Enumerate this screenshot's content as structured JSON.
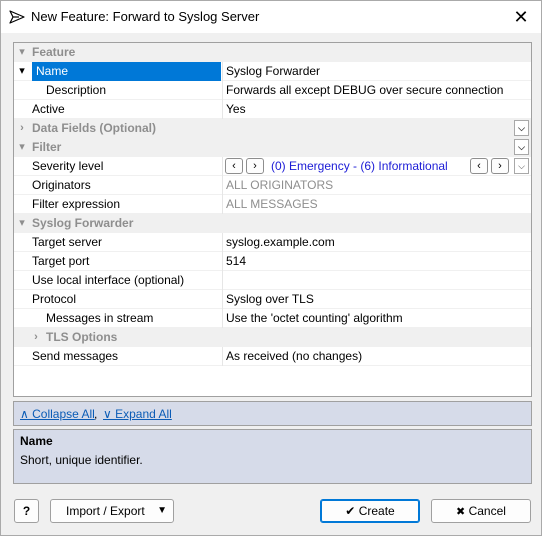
{
  "window": {
    "title": "New Feature: Forward to Syslog Server",
    "close_icon": "✕",
    "app_icon": "send-icon"
  },
  "colors": {
    "selection": "#0078d7",
    "link": "#0b5cb6",
    "category_text": "#8e8e8e",
    "panel": "#d6dbe9",
    "value_blue": "#1b1bd6"
  },
  "grid": {
    "feature": {
      "label": "Feature",
      "toggle": "▾"
    },
    "name": {
      "label": "Name",
      "value": "Syslog Forwarder",
      "toggle": "▾"
    },
    "description": {
      "label": "Description",
      "value": "Forwards all except DEBUG over secure connection"
    },
    "active": {
      "label": "Active",
      "value": "Yes"
    },
    "data_fields": {
      "label": "Data Fields (Optional)",
      "toggle": "›",
      "dropdown": "⌵"
    },
    "filter": {
      "label": "Filter",
      "toggle": "▾",
      "dropdown": "⌵"
    },
    "severity": {
      "label": "Severity level",
      "value": "(0) Emergency - (6) Informational",
      "prev": "‹",
      "next": "›",
      "dropdown": "⌵"
    },
    "originators": {
      "label": "Originators",
      "value": "ALL ORIGINATORS"
    },
    "filter_expression": {
      "label": "Filter expression",
      "value": "ALL MESSAGES"
    },
    "syslog_forwarder": {
      "label": "Syslog Forwarder",
      "toggle": "▾"
    },
    "target_server": {
      "label": "Target server",
      "value": "syslog.example.com"
    },
    "target_port": {
      "label": "Target port",
      "value": "514"
    },
    "local_interface": {
      "label": "Use local interface (optional)",
      "value": ""
    },
    "protocol": {
      "label": "Protocol",
      "value": "Syslog over TLS"
    },
    "messages_in_stream": {
      "label": "Messages in stream",
      "value": "Use the 'octet counting' algorithm"
    },
    "tls_options": {
      "label": "TLS Options",
      "toggle": "›"
    },
    "send_messages": {
      "label": "Send messages",
      "value": "As received (no changes)"
    }
  },
  "links": {
    "collapse_all": "∧ Collapse All",
    "separator": ",",
    "expand_all": "∨ Expand All"
  },
  "help": {
    "title": "Name",
    "text": "Short, unique identifier."
  },
  "buttons": {
    "help": "?",
    "import_export": "Import / Export",
    "import_export_arrow": "▼",
    "create": "Create",
    "create_icon": "✔",
    "cancel": "Cancel",
    "cancel_icon": "✖"
  }
}
